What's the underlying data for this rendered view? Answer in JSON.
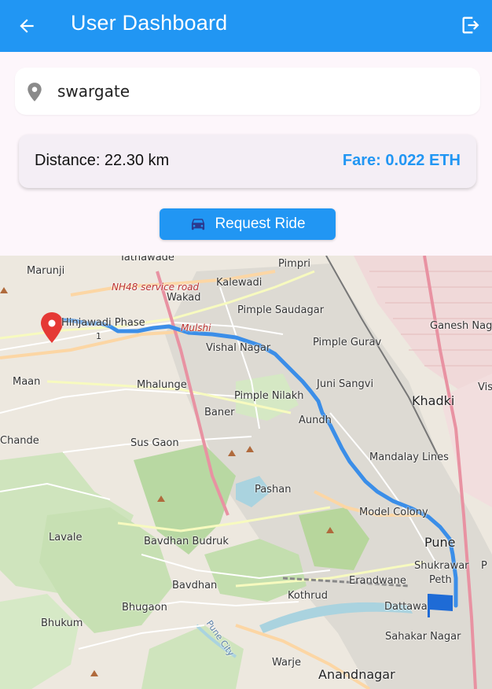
{
  "appbar": {
    "title": "User Dashboard",
    "back_icon": "arrow-back-icon",
    "logout_icon": "logout-icon",
    "color": "#2196f3"
  },
  "search": {
    "icon": "location-pin-icon",
    "value": "swargate"
  },
  "trip": {
    "distance": "Distance: 22.30 km",
    "fare": "Fare: 0.022 ETH"
  },
  "request_button": {
    "icon": "car-icon",
    "label": "Request Ride"
  },
  "map": {
    "route_color": "#3b8ee8",
    "start_marker": "red-pin-icon",
    "end_marker": "blue-flag-icon",
    "labels": {
      "tathawade": "Tathawade",
      "pimpri": "Pimpri",
      "marunji": "Marunji",
      "kalewadi": "Kalewadi",
      "nh48": "NH48 service road",
      "wakad": "Wakad",
      "pimple_saudagar": "Pimple Saudagar",
      "hinjawadi": "Hinjawadi Phase",
      "hinjawadi_num": "1",
      "mulshi": "Mulshi",
      "ganesh_nagar": "Ganesh Nag",
      "vishal_nagar": "Vishal Nagar",
      "pimple_gurav": "Pimple Gurav",
      "maan": "Maan",
      "mhalunge": "Mhalunge",
      "juni_sangvi": "Juni Sangvi",
      "visrantwadi": "Vis",
      "pimple_nilakh": "Pimple Nilakh",
      "khadki": "Khadki",
      "baner": "Baner",
      "aundh": "Aundh",
      "chande": "Chande",
      "sus_gaon": "Sus Gaon",
      "mandalay_lines": "Mandalay Lines",
      "pashan": "Pashan",
      "model_colony": "Model Colony",
      "lavale": "Lavale",
      "bavdhan_budruk": "Bavdhan Budruk",
      "pune": "Pune",
      "shukrawar_peth": "Shukrawar",
      "peth": "Peth",
      "bavdhan": "Bavdhan",
      "erandwane": "Erandwane",
      "kothrud": "Kothrud",
      "bhugaon": "Bhugaon",
      "dattawadi": "Dattawa",
      "bhukum": "Bhukum",
      "sahakar_nagar": "Sahakar Nagar",
      "pune_city": "Pune City",
      "warje": "Warje",
      "anandnagar": "Anandnagar",
      "p_edge": "P"
    }
  }
}
